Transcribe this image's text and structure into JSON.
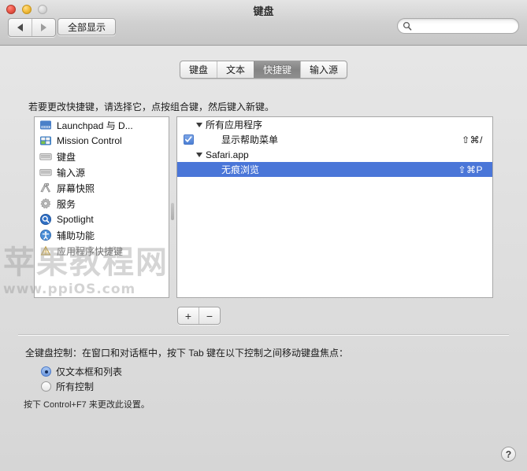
{
  "window": {
    "title": "键盘",
    "traffic_lights": [
      "close",
      "minimize",
      "maximize"
    ],
    "nav_back": "◀",
    "nav_forward": "▶",
    "show_all_label": "全部显示",
    "search_placeholder": "",
    "search_value": ""
  },
  "tabs": [
    {
      "label": "键盘",
      "selected": false
    },
    {
      "label": "文本",
      "selected": false
    },
    {
      "label": "快捷键",
      "selected": true
    },
    {
      "label": "输入源",
      "selected": false
    }
  ],
  "instruction": "若要更改快捷键，请选择它，点按组合键，然后键入新键。",
  "sidebar": {
    "items": [
      {
        "label": "Launchpad 与 D...",
        "icon": "launchpad-dock-icon",
        "dim": false
      },
      {
        "label": "Mission Control",
        "icon": "mission-control-icon",
        "dim": false
      },
      {
        "label": "键盘",
        "icon": "keyboard-icon",
        "dim": false
      },
      {
        "label": "输入源",
        "icon": "input-source-icon",
        "dim": false
      },
      {
        "label": "屏幕快照",
        "icon": "screenshot-icon",
        "dim": false
      },
      {
        "label": "服务",
        "icon": "services-gear-icon",
        "dim": false
      },
      {
        "label": "Spotlight",
        "icon": "spotlight-icon",
        "dim": false
      },
      {
        "label": "辅助功能",
        "icon": "accessibility-icon",
        "dim": false
      },
      {
        "label": "应用程序快捷键",
        "icon": "app-shortcuts-icon",
        "dim": true
      }
    ]
  },
  "shortcuts": {
    "rows": [
      {
        "type": "group",
        "label": "所有应用程序",
        "expanded": true,
        "keys": "",
        "checked": null,
        "selected": false
      },
      {
        "type": "leaf",
        "label": "显示帮助菜单",
        "keys": "⇧⌘/",
        "checked": true,
        "selected": false
      },
      {
        "type": "group",
        "label": "Safari.app",
        "expanded": true,
        "keys": "",
        "checked": null,
        "selected": false
      },
      {
        "type": "leaf",
        "label": "无痕浏览",
        "keys": "⇧⌘P",
        "checked": false,
        "selected": true
      }
    ]
  },
  "add_remove": {
    "add_label": "+",
    "remove_label": "−"
  },
  "full_keyboard": {
    "label": "全键盘控制：在窗口和对话框中，按下 Tab 键在以下控制之间移动键盘焦点：",
    "options": [
      {
        "label": "仅文本框和列表",
        "selected": true
      },
      {
        "label": "所有控制",
        "selected": false
      }
    ],
    "hint": "按下 Control+F7 来更改此设置。"
  },
  "help_label": "?",
  "watermark": {
    "main": "苹果教程网",
    "sub": "www.ppiOS.com"
  },
  "colors": {
    "selection_blue": "#4a76d8",
    "tab_selected_gray": "#8a8a8a",
    "panel_white": "#ffffff",
    "window_gray": "#ececec"
  }
}
